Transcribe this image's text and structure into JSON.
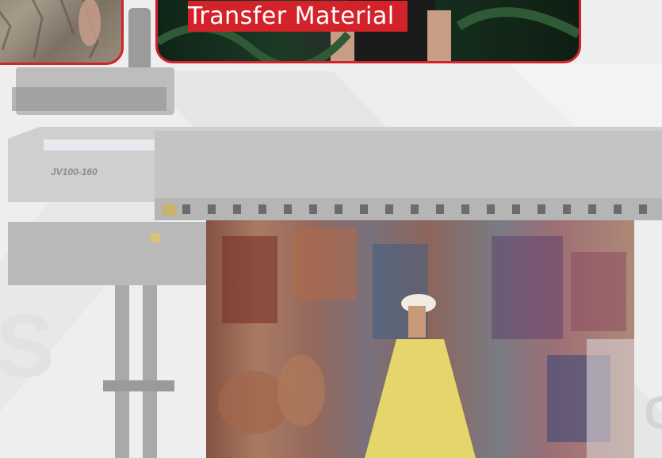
{
  "banner": {
    "caption": "Transfer Material"
  },
  "printer": {
    "model_label": "JV100-160"
  },
  "background": {
    "watermark_letter": "S",
    "edge_letter": "C"
  },
  "colors": {
    "accent": "#d3222a",
    "background": "#eeeeee"
  }
}
